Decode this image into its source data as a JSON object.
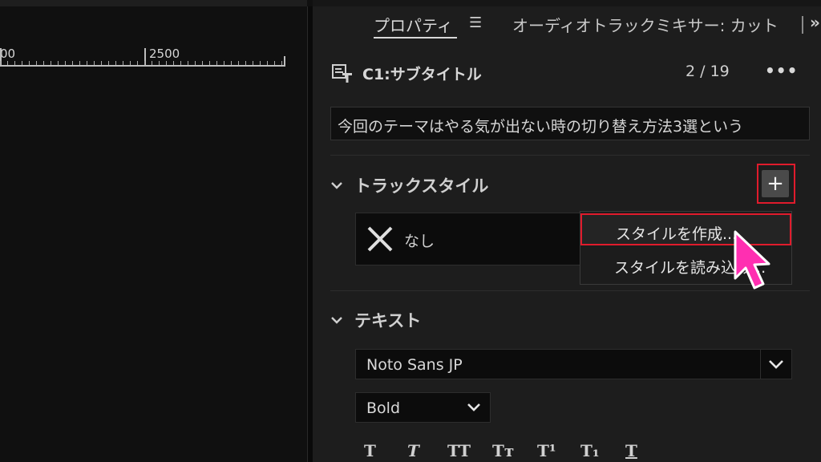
{
  "timeline": {
    "ruler_labels": [
      "00",
      "2500"
    ]
  },
  "tabs": {
    "active": "プロパティ",
    "menu_icon": "hamburger-icon",
    "other": "オーディオトラックミキサー: カット",
    "more": "»"
  },
  "clip": {
    "name": "C1:サブタイトル",
    "index": "2 / 19",
    "more": "•••",
    "caption": "今回のテーマはやる気が出ない時の切り替え方法3選という"
  },
  "track_style": {
    "title": "トラックスタイル",
    "add_button": "+",
    "current": "なし",
    "menu": [
      "スタイルを作成...",
      "スタイルを読み込み..."
    ]
  },
  "text_section": {
    "title": "テキスト",
    "font": "Noto Sans JP",
    "weight": "Bold",
    "format_buttons": [
      "T",
      "T",
      "TT",
      "Tт",
      "T¹",
      "T₁",
      "T"
    ]
  },
  "colors": {
    "accent_red": "#e01b2c",
    "cursor_pink": "#ff2fb1"
  }
}
